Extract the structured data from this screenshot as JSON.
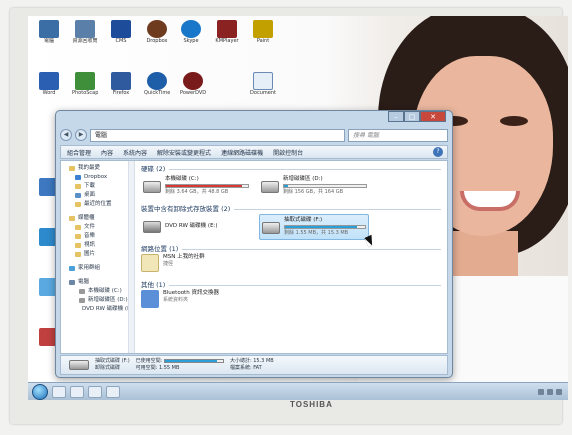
{
  "window": {
    "address": "電腦",
    "search_placeholder": "搜尋 電腦",
    "buttons": {
      "minimize": "–",
      "maximize": "□",
      "close": "✕"
    }
  },
  "toolbar": {
    "items": [
      "組合管理",
      "內容",
      "系統內容",
      "解除安裝或變更程式",
      "連線網路磁碟機",
      "開啟控制台"
    ],
    "help": "?"
  },
  "navpane": {
    "favorites": "我的最愛",
    "dropbox": "Dropbox",
    "download": "下載",
    "desktop": "桌面",
    "recent": "最近的位置",
    "libraries": "媒體櫃",
    "docs": "文件",
    "music": "音樂",
    "video": "視訊",
    "pictures": "圖片",
    "homegroup": "家用群組",
    "computer": "電腦",
    "local_c": "本機磁碟 (C:)",
    "new_d": "新增磁碟區 (D:)",
    "dvd_e": "DVD RW 磁碟機 (E:)"
  },
  "groups": {
    "hdd": "硬碟 (2)",
    "removable": "裝置中含有卸除式存放裝置 (2)",
    "network": "網路位置 (1)",
    "other": "其他 (1)"
  },
  "drives": {
    "c": {
      "name": "本機磁碟 (C:)",
      "meta": "剩餘 3.64 GB，共 48.8 GB",
      "fill": 0.93,
      "color": "#d43a3a"
    },
    "d": {
      "name": "新增磁碟區 (D:)",
      "meta": "剩餘 156 GB，共 164 GB",
      "fill": 0.05,
      "color": "#2b9fd8"
    },
    "e": {
      "name": "DVD RW 磁碟機 (E:)"
    },
    "f": {
      "name": "抽取式磁碟 (F:)",
      "meta": "剩餘 1.55 MB，共 15.3 MB",
      "fill": 0.9,
      "color": "#2b9fd8"
    }
  },
  "network_item": {
    "name": "MSN 上我的社群",
    "desc": "捷徑"
  },
  "other_item": {
    "name": "Bluetooth 資訊交換器",
    "desc": "系統資料夾"
  },
  "details": {
    "name": "抽取式磁碟 (F:)",
    "type": "卸除式磁碟",
    "used_label": "已使用空間:",
    "free_label": "可用空間:",
    "free_value": "1.55 MB",
    "total_label": "大小總計:",
    "total_value": "15.3 MB",
    "fs_label": "檔案系統:",
    "fs_value": "FAT",
    "used_fraction": 0.9
  },
  "desktop_icons": [
    "電腦",
    "資源回收筒",
    "CMS",
    "Dropbox",
    "Skype",
    "KMPlayer",
    "Word",
    "PhotoScape",
    "Firefox",
    "QuickTime",
    "PowerDVD",
    "Paint",
    "Document"
  ],
  "monitor_brand": "TOSHIBA"
}
